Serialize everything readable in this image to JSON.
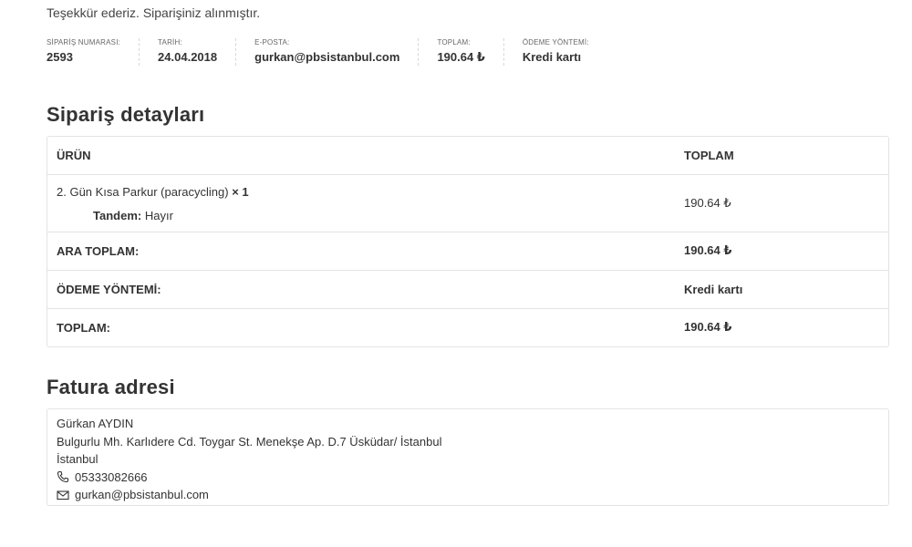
{
  "thank_you": "Teşekkür ederiz. Siparişiniz alınmıştır.",
  "overview": [
    {
      "label": "SİPARİŞ NUMARASI:",
      "value": "2593"
    },
    {
      "label": "TARİH:",
      "value": "24.04.2018"
    },
    {
      "label": "E-POSTA:",
      "value": "gurkan@pbsistanbul.com"
    },
    {
      "label": "TOPLAM:",
      "value": "190.64 ₺"
    },
    {
      "label": "ÖDEME YÖNTEMİ:",
      "value": "Kredi kartı"
    }
  ],
  "order_details": {
    "title": "Sipariş detayları",
    "headers": {
      "product": "ÜRÜN",
      "total": "TOPLAM"
    },
    "item": {
      "name": "2. Gün Kısa Parkur (paracycling)",
      "qty": "× 1",
      "meta_key": "Tandem:",
      "meta_value": "Hayır",
      "total": "190.64 ₺"
    },
    "totals": [
      {
        "label": "ARA TOPLAM:",
        "value": "190.64 ₺"
      },
      {
        "label": "ÖDEME YÖNTEMİ:",
        "value": "Kredi kartı"
      },
      {
        "label": "TOPLAM:",
        "value": "190.64 ₺"
      }
    ]
  },
  "billing": {
    "title": "Fatura adresi",
    "name": "Gürkan AYDIN",
    "street": "Bulgurlu Mh. Karlıdere Cd. Toygar St. Menekşe Ap. D.7 Üsküdar/ İstanbul",
    "city": "İstanbul",
    "phone": "05333082666",
    "email": "gurkan@pbsistanbul.com"
  },
  "icons": {
    "phone": "phone-icon",
    "email": "envelope-icon"
  }
}
